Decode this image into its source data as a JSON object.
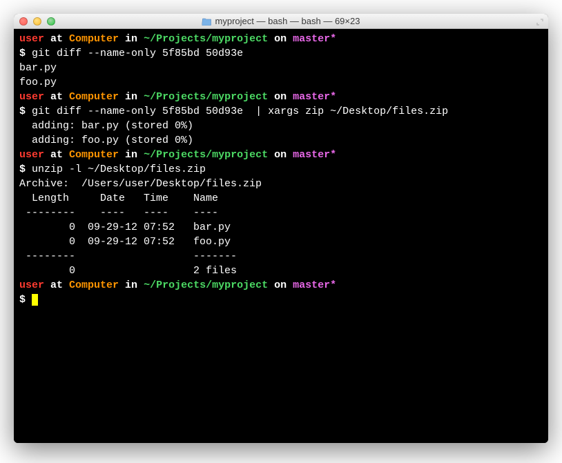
{
  "window": {
    "title": "myproject — bash — bash — 69×23"
  },
  "prompt": {
    "user": "user",
    "at": " at ",
    "host": "Computer",
    "in": " in ",
    "path": "~/Projects/myproject",
    "on": " on ",
    "branch": "master*",
    "symbol": "$ "
  },
  "commands": {
    "cmd1": "git diff --name-only 5f85bd 50d93e",
    "cmd2": "git diff --name-only 5f85bd 50d93e  | xargs zip ~/Desktop/files.zip",
    "cmd3": "unzip -l ~/Desktop/files.zip"
  },
  "output": {
    "diff1_line1": "bar.py",
    "diff1_line2": "foo.py",
    "zip_line1": "  adding: bar.py (stored 0%)",
    "zip_line2": "  adding: foo.py (stored 0%)",
    "archive_header": "Archive:  /Users/user/Desktop/files.zip",
    "unzip_header": "  Length     Date   Time    Name",
    "unzip_sep1": " --------    ----   ----    ----",
    "unzip_row1": "        0  09-29-12 07:52   bar.py",
    "unzip_row2": "        0  09-29-12 07:52   foo.py",
    "unzip_sep2": " --------                   -------",
    "unzip_total": "        0                   2 files"
  }
}
